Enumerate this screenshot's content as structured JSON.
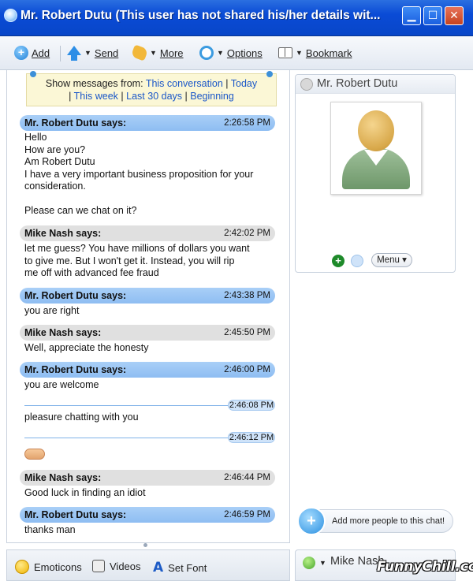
{
  "window": {
    "title": "Mr. Robert Dutu (This user has not shared his/her details wit...",
    "controls": [
      "minimize",
      "maximize",
      "close"
    ]
  },
  "toolbar": {
    "add": "Add",
    "send": "Send",
    "more": "More",
    "options": "Options",
    "bookmark": "Bookmark"
  },
  "filter": {
    "prefix": "Show messages from:",
    "links": [
      "This conversation",
      "Today",
      "This week",
      "Last 30 days",
      "Beginning"
    ]
  },
  "messages": [
    {
      "sender": "Mr. Robert Dutu says:",
      "time": "2:26:58 PM",
      "lines": [
        "Hello",
        "How are you?",
        "Am Robert Dutu",
        "I have a very important business proposition for your",
        "consideration.",
        "",
        "Please can we chat on it?"
      ]
    },
    {
      "sender": "Mike Nash says:",
      "time": "2:42:02 PM",
      "lines": [
        "let me guess?  You have millions of dollars you want",
        "to give me.  But I won't get it.  Instead, you will rip",
        "me off with advanced fee fraud"
      ]
    },
    {
      "sender": "Mr. Robert Dutu says:",
      "time": "2:43:38 PM",
      "lines": [
        "you are right"
      ]
    },
    {
      "sender": "Mike Nash says:",
      "time": "2:45:50 PM",
      "lines": [
        "Well, appreciate the honesty"
      ]
    },
    {
      "sender": "Mr. Robert Dutu says:",
      "time": "2:46:00 PM",
      "lines": [
        "you are welcome"
      ]
    },
    {
      "time": "2:46:08 PM",
      "lines": [
        "pleasure chatting with you"
      ]
    },
    {
      "time": "2:46:12 PM",
      "emoticon": "handshake-icon"
    },
    {
      "sender": "Mike Nash says:",
      "time": "2:46:44 PM",
      "lines": [
        "Good luck in finding an idiot"
      ]
    },
    {
      "sender": "Mr. Robert Dutu says:",
      "time": "2:46:59 PM",
      "lines": [
        "thanks man"
      ]
    }
  ],
  "bottom": {
    "emoticons": "Emoticons",
    "videos": "Videos",
    "set_font": "Set Font"
  },
  "contact": {
    "name": "Mr. Robert Dutu",
    "menu": "Menu"
  },
  "add_people": "Add more people to this chat!",
  "self": {
    "name": "Mike Nash"
  },
  "watermark": "FunnyChill.com",
  "colors": {
    "titlebar": "#0a4bd6",
    "them_header": "#a9cff7",
    "me_header": "#e0e0e0",
    "link": "#1b57c8"
  }
}
